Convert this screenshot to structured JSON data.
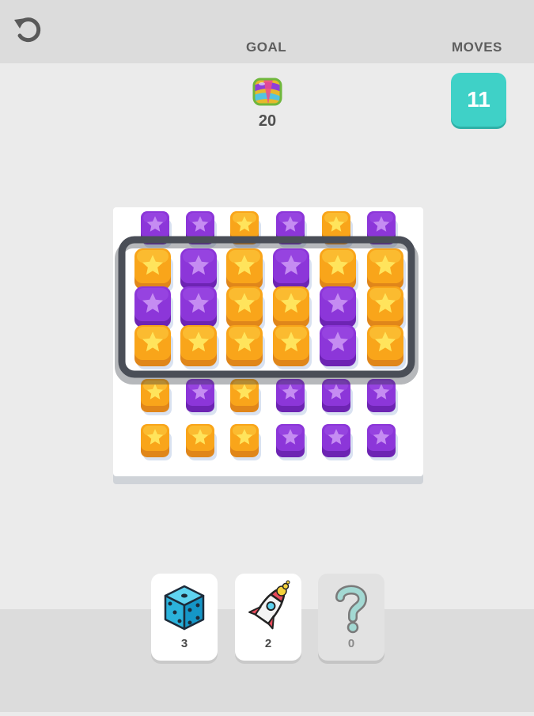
{
  "hud": {
    "goal_label": "GOAL",
    "moves_label": "MOVES",
    "goal_count": "20",
    "moves_left": "11"
  },
  "colors": {
    "orange": "#f9a51a",
    "purple": "#8c36d9",
    "moves_teal": "#3fd1c7",
    "board": "#ffffff",
    "frame": "#4a4e57"
  },
  "board": {
    "rows": [
      [
        "purple",
        "purple",
        "orange",
        "purple",
        "orange",
        "purple"
      ],
      [
        "orange",
        "purple",
        "orange",
        "purple",
        "orange",
        "orange"
      ],
      [
        "purple",
        "purple",
        "orange",
        "orange",
        "purple",
        "orange"
      ],
      [
        "orange",
        "orange",
        "orange",
        "orange",
        "purple",
        "orange"
      ],
      [
        "orange",
        "purple",
        "orange",
        "purple",
        "purple",
        "purple"
      ],
      [
        "orange",
        "orange",
        "orange",
        "purple",
        "purple",
        "purple"
      ]
    ],
    "selected_rows": [
      1,
      2,
      3
    ]
  },
  "boosters": [
    {
      "icon": "dice-icon",
      "count": "3"
    },
    {
      "icon": "rocket-icon",
      "count": "2"
    },
    {
      "icon": "question-icon",
      "count": "0"
    }
  ]
}
